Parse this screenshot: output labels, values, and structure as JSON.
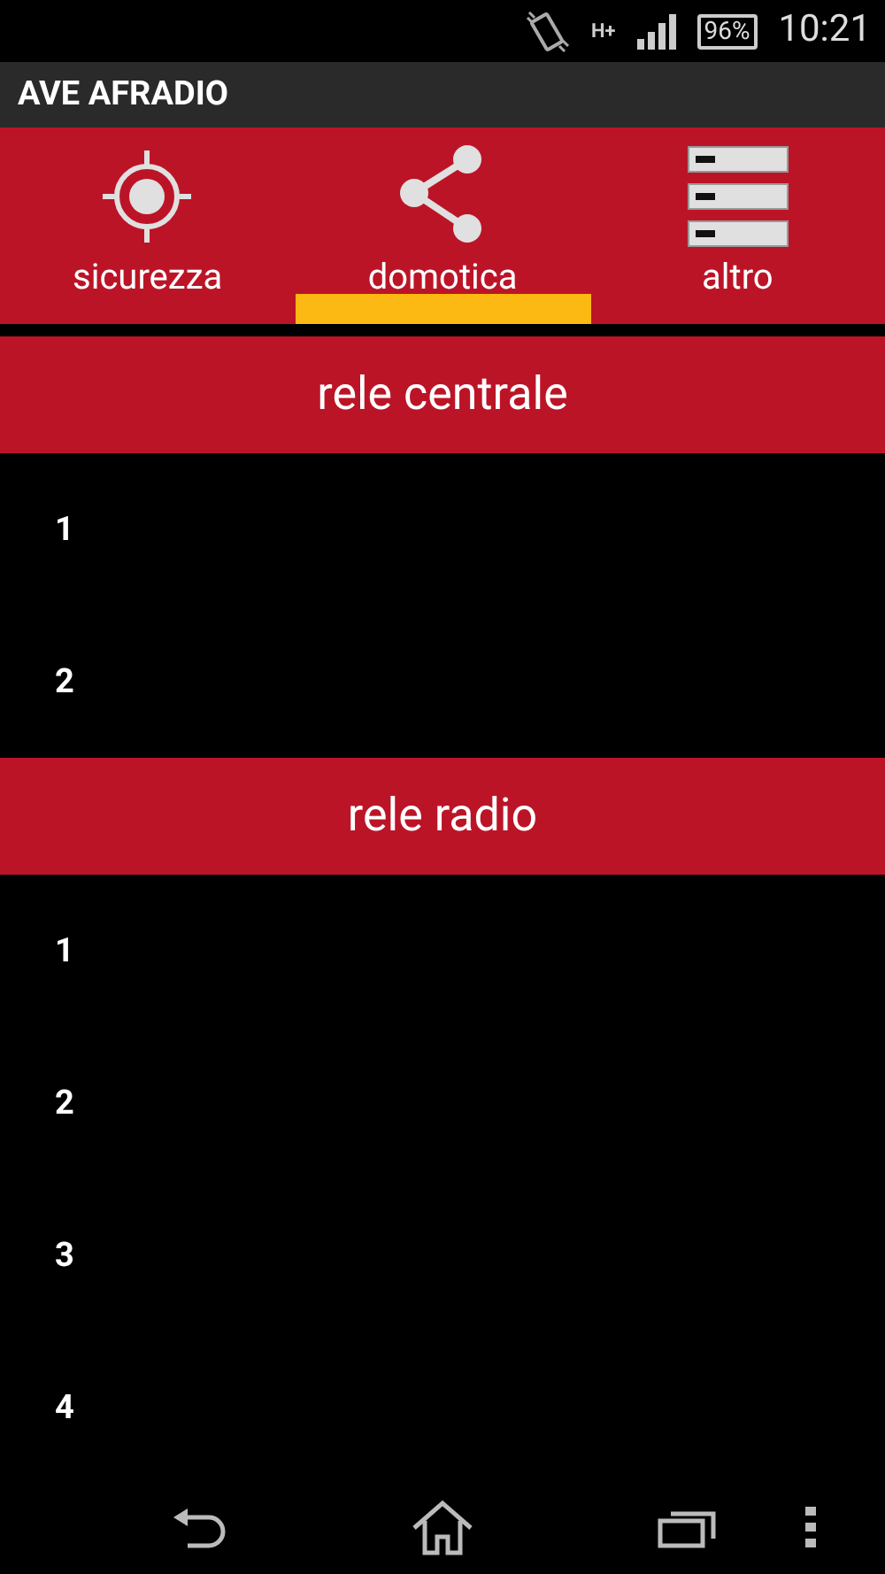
{
  "status_bar": {
    "network": "H+",
    "battery": "96%",
    "time": "10:21"
  },
  "action_bar": {
    "title": "AVE AFRADIO"
  },
  "tabs": [
    {
      "label": "sicurezza",
      "kind": "target",
      "selected": false
    },
    {
      "label": "domotica",
      "kind": "share",
      "selected": true
    },
    {
      "label": "altro",
      "kind": "list",
      "selected": false
    }
  ],
  "sections": [
    {
      "title": "rele centrale",
      "items": [
        "1",
        "2"
      ]
    },
    {
      "title": "rele radio",
      "items": [
        "1",
        "2",
        "3",
        "4"
      ]
    }
  ]
}
